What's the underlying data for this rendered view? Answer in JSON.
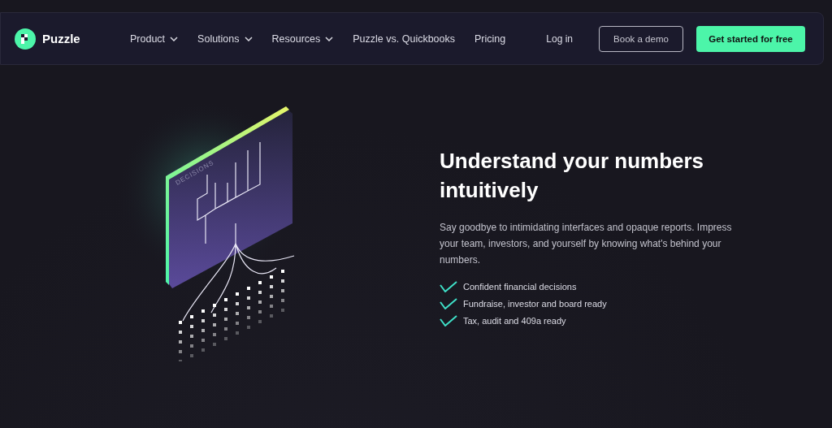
{
  "brand": {
    "name": "Puzzle"
  },
  "nav": [
    {
      "label": "Product",
      "dropdown": true
    },
    {
      "label": "Solutions",
      "dropdown": true
    },
    {
      "label": "Resources",
      "dropdown": true
    },
    {
      "label": "Puzzle vs. Quickbooks",
      "dropdown": false
    },
    {
      "label": "Pricing",
      "dropdown": false
    }
  ],
  "login": "Log in",
  "buttons": [
    {
      "label": "Book a demo",
      "kind": "outline"
    },
    {
      "label": "Get started for free",
      "kind": "primary"
    }
  ],
  "illustration": {
    "label": "DECISIONS"
  },
  "hero": {
    "title": "Understand your numbers intuitively",
    "text": "Say goodbye to intimidating interfaces and opaque reports. Impress your team, investors, and yourself by knowing what's behind your numbers.",
    "features": [
      "Confident financial decisions",
      "Fundraise, investor and board ready",
      "Tax, audit and 409a ready"
    ]
  }
}
